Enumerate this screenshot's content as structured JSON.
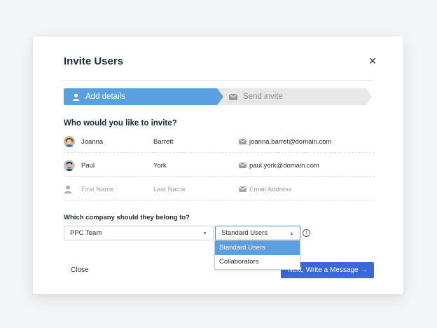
{
  "modal": {
    "title": "Invite Users",
    "close_icon": "close-icon"
  },
  "stepper": {
    "steps": [
      {
        "label": "Add details",
        "icon": "user-icon",
        "active": true
      },
      {
        "label": "Send invite",
        "icon": "envelope-icon",
        "active": false
      }
    ]
  },
  "invite": {
    "question": "Who would you like to invite?",
    "rows": [
      {
        "first": "Joanna",
        "last": "Barrett",
        "email": "joanna.barret@domain.com"
      },
      {
        "first": "Paul",
        "last": "York",
        "email": "paul.york@domain.com"
      }
    ],
    "placeholders": {
      "first": "First Name",
      "last": "Last Name",
      "email": "Email Address"
    }
  },
  "company": {
    "label": "Which company should they belong to?",
    "selected_company": "PPC Team",
    "selected_role": "Standard Users",
    "role_options": [
      "Standard Users",
      "Collaborators"
    ]
  },
  "footer": {
    "close_label": "Close",
    "next_label": "Next, Write a Message →"
  },
  "colors": {
    "accent": "#5a9fe0",
    "primary_button": "#3b67d9",
    "inactive_step": "#e8e8e8"
  }
}
